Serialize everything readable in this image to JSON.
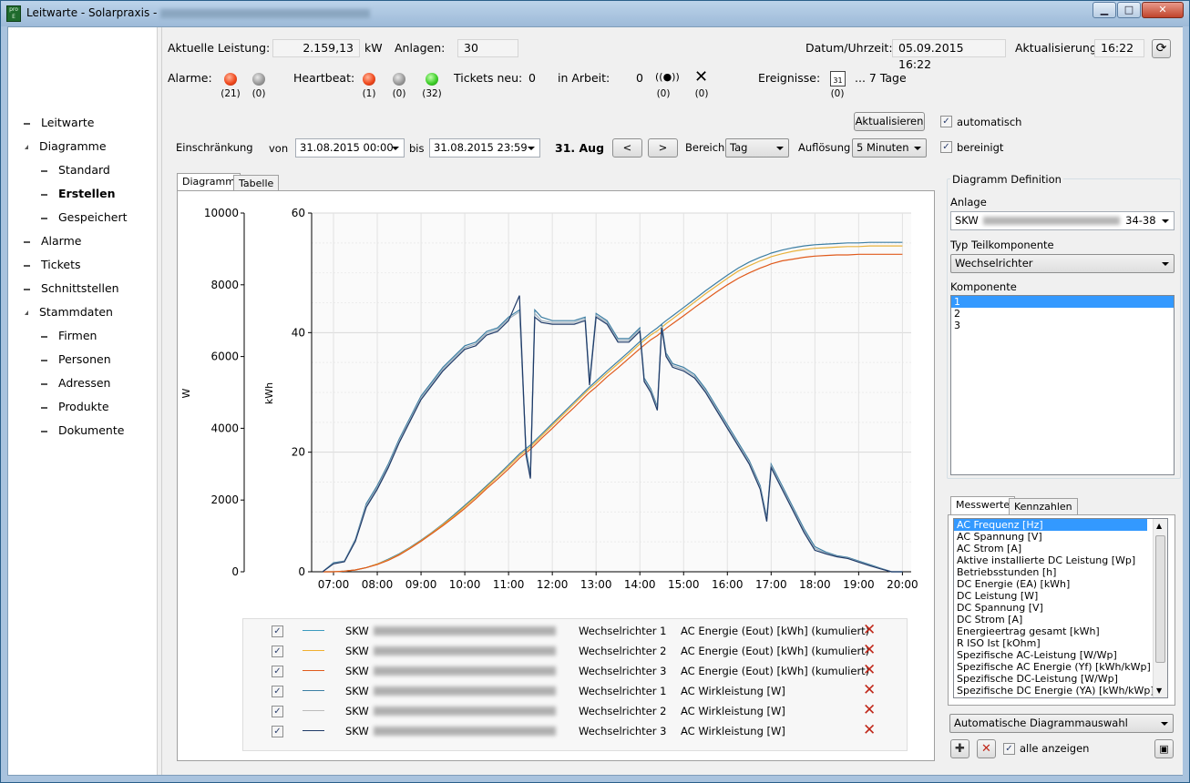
{
  "window": {
    "title": "Leitwarte - Solarpraxis -",
    "controls": {
      "minimize": "▁",
      "maximize": "□",
      "close": "✕"
    },
    "icon_text": "pro E"
  },
  "sidebar": {
    "items": [
      {
        "label": "Leitwarte",
        "level": 0
      },
      {
        "label": "Diagramme",
        "level": 0,
        "expanded": true
      },
      {
        "label": "Standard",
        "level": 1
      },
      {
        "label": "Erstellen",
        "level": 1,
        "selected": true
      },
      {
        "label": "Gespeichert",
        "level": 1
      },
      {
        "label": "Alarme",
        "level": 0
      },
      {
        "label": "Tickets",
        "level": 0
      },
      {
        "label": "Schnittstellen",
        "level": 0
      },
      {
        "label": "Stammdaten",
        "level": 0,
        "expanded": true
      },
      {
        "label": "Firmen",
        "level": 1
      },
      {
        "label": "Personen",
        "level": 1
      },
      {
        "label": "Adressen",
        "level": 1
      },
      {
        "label": "Produkte",
        "level": 1
      },
      {
        "label": "Dokumente",
        "level": 1
      }
    ]
  },
  "status": {
    "leistung_label": "Aktuelle Leistung:",
    "leistung_value": "2.159,13",
    "leistung_unit": "kW",
    "anlagen_label": "Anlagen:",
    "anlagen_value": "30",
    "datum_label": "Datum/Uhrzeit:",
    "datum_value": "05.09.2015 16:22",
    "aktualisierung_label": "Aktualisierung:",
    "aktualisierung_value": "16:22",
    "alarme_label": "Alarme:",
    "alarme_counts": [
      "(21)",
      "(0)"
    ],
    "heartbeat_label": "Heartbeat:",
    "heartbeat_counts": [
      "(1)",
      "(0)",
      "(32)"
    ],
    "tickets_neu_label": "Tickets neu:",
    "tickets_neu_value": "0",
    "in_arbeit_label": "in Arbeit:",
    "in_arbeit_value": "0",
    "ticket_icon_counts": [
      "(0)",
      "(0)"
    ],
    "ereignisse_label": "Ereignisse:",
    "ereignisse_value": "... 7 Tage",
    "ereignisse_count": "(0)",
    "calendar_day": "31"
  },
  "toolbar": {
    "aktualisieren_button": "Aktualisieren",
    "automatisch_label": "automatisch",
    "bereinigt_label": "bereinigt",
    "einschraenkung_label": "Einschränkung",
    "von_label": "von",
    "von_value": "31.08.2015 00:00",
    "bis_label": "bis",
    "bis_value": "31.08.2015 23:59",
    "date_display": "31. Aug",
    "prev_button": "<",
    "next_button": ">",
    "bereich_label": "Bereich",
    "bereich_value": "Tag",
    "aufloesung_label": "Auflösung",
    "aufloesung_value": "5 Minuten"
  },
  "tabs": {
    "diagramm": "Diagramm",
    "tabelle": "Tabelle"
  },
  "chart_data": {
    "type": "line",
    "y_left_label": "W",
    "y_right_label": "kWh",
    "y_left_ticks": [
      "10000",
      "8000",
      "6000",
      "4000",
      "2000",
      "0"
    ],
    "y_right_ticks": [
      "60",
      "40",
      "20",
      "0"
    ],
    "x_ticks": [
      "07:00",
      "08:00",
      "09:00",
      "10:00",
      "11:00",
      "12:00",
      "13:00",
      "14:00",
      "15:00",
      "16:00",
      "17:00",
      "18:00",
      "19:00",
      "20:00"
    ],
    "x": [
      6.75,
      7.0,
      7.25,
      7.5,
      7.75,
      8.0,
      8.25,
      8.5,
      8.75,
      9.0,
      9.25,
      9.5,
      9.75,
      10.0,
      10.25,
      10.5,
      10.75,
      11.0,
      11.25,
      11.4,
      11.5,
      11.6,
      11.75,
      12.0,
      12.25,
      12.5,
      12.75,
      12.85,
      13.0,
      13.25,
      13.5,
      13.75,
      14.0,
      14.1,
      14.25,
      14.4,
      14.5,
      14.6,
      14.75,
      15.0,
      15.25,
      15.5,
      15.75,
      16.0,
      16.25,
      16.5,
      16.75,
      16.9,
      17.0,
      17.25,
      17.5,
      17.75,
      18.0,
      18.25,
      18.5,
      18.75,
      19.0,
      19.25,
      19.5,
      19.75,
      20.0
    ],
    "power_series": [
      {
        "name": "Wechselrichter 1",
        "unit": "W",
        "color": "#3c7ea3",
        "values": [
          0,
          250,
          300,
          900,
          1900,
          2400,
          3000,
          3700,
          4300,
          4900,
          5300,
          5700,
          6000,
          6300,
          6400,
          6700,
          6800,
          7100,
          7300,
          3400,
          2700,
          7300,
          7100,
          7000,
          7000,
          7000,
          7100,
          5300,
          7200,
          7000,
          6500,
          6500,
          6800,
          5400,
          5100,
          4600,
          6900,
          6100,
          5800,
          5700,
          5500,
          5100,
          4600,
          4100,
          3600,
          3100,
          2400,
          1500,
          3000,
          2400,
          1800,
          1200,
          700,
          550,
          450,
          400,
          300,
          200,
          100,
          0,
          0
        ]
      },
      {
        "name": "Wechselrichter 2",
        "unit": "W",
        "color": "#9fb0bd",
        "values": [
          0,
          230,
          290,
          870,
          1850,
          2350,
          2950,
          3650,
          4250,
          4850,
          5250,
          5650,
          5950,
          6250,
          6350,
          6650,
          6750,
          7050,
          7250,
          3300,
          2650,
          7200,
          7000,
          6950,
          6950,
          6950,
          7050,
          5250,
          7150,
          6950,
          6450,
          6450,
          6750,
          5350,
          5050,
          4550,
          6850,
          6050,
          5750,
          5650,
          5450,
          5050,
          4550,
          4050,
          3550,
          3050,
          2350,
          1450,
          2950,
          2350,
          1750,
          1150,
          650,
          520,
          430,
          380,
          280,
          180,
          90,
          0,
          0
        ]
      },
      {
        "name": "Wechselrichter 3",
        "unit": "W",
        "color": "#1f3a68",
        "values": [
          0,
          220,
          280,
          850,
          1800,
          2300,
          2900,
          3600,
          4200,
          4800,
          5200,
          5600,
          5900,
          6200,
          6300,
          6600,
          6700,
          7000,
          7700,
          3250,
          2600,
          7100,
          6950,
          6900,
          6900,
          6900,
          7000,
          5200,
          7100,
          6900,
          6400,
          6400,
          6700,
          5300,
          5000,
          4500,
          6800,
          6000,
          5700,
          5600,
          5400,
          5000,
          4500,
          4000,
          3500,
          3000,
          2300,
          1400,
          2900,
          2300,
          1700,
          1100,
          600,
          500,
          420,
          370,
          270,
          170,
          80,
          0,
          0
        ]
      }
    ],
    "energy_series": [
      {
        "name": "Wechselrichter 1",
        "unit": "kWh",
        "color": "#3c7ea3",
        "values": [
          0,
          0,
          0.1,
          0.3,
          0.7,
          1.3,
          2.1,
          3.0,
          4.1,
          5.3,
          6.6,
          8.0,
          9.5,
          11.1,
          12.7,
          14.4,
          16.1,
          17.9,
          19.7,
          20.6,
          21.2,
          21.9,
          23.0,
          24.8,
          26.6,
          28.4,
          30.2,
          30.9,
          31.9,
          33.6,
          35.2,
          36.8,
          38.5,
          39.1,
          40.0,
          40.8,
          41.4,
          42.0,
          42.8,
          44.2,
          45.6,
          47.0,
          48.3,
          49.6,
          50.8,
          51.8,
          52.6,
          53.0,
          53.3,
          53.8,
          54.2,
          54.5,
          54.7,
          54.8,
          54.9,
          55.0,
          55.0,
          55.1,
          55.1,
          55.1,
          55.1
        ]
      },
      {
        "name": "Wechselrichter 2",
        "unit": "kWh",
        "color": "#e8b23c",
        "values": [
          0,
          0,
          0.1,
          0.3,
          0.7,
          1.3,
          2.0,
          2.9,
          4.0,
          5.2,
          6.5,
          7.9,
          9.3,
          10.9,
          12.5,
          14.2,
          15.9,
          17.6,
          19.4,
          20.3,
          20.9,
          21.6,
          22.7,
          24.5,
          26.3,
          28.1,
          29.9,
          30.6,
          31.5,
          33.2,
          34.8,
          36.4,
          38.1,
          38.7,
          39.6,
          40.3,
          40.9,
          41.5,
          42.3,
          43.7,
          45.1,
          46.5,
          47.8,
          49.1,
          50.3,
          51.2,
          52.0,
          52.4,
          52.7,
          53.2,
          53.6,
          53.9,
          54.1,
          54.2,
          54.3,
          54.4,
          54.4,
          54.5,
          54.5,
          54.5,
          54.5
        ]
      },
      {
        "name": "Wechselrichter 3",
        "unit": "kWh",
        "color": "#e05a1c",
        "values": [
          0,
          0,
          0.1,
          0.3,
          0.7,
          1.2,
          1.9,
          2.8,
          3.9,
          5.1,
          6.4,
          7.7,
          9.1,
          10.6,
          12.2,
          13.9,
          15.5,
          17.2,
          19.0,
          19.9,
          20.5,
          21.2,
          22.3,
          24.0,
          25.8,
          27.5,
          29.3,
          30.0,
          30.9,
          32.6,
          34.1,
          35.7,
          37.3,
          37.9,
          38.8,
          39.5,
          40.1,
          40.7,
          41.5,
          42.8,
          44.2,
          45.5,
          46.8,
          48.0,
          49.1,
          50.0,
          50.8,
          51.2,
          51.5,
          52.0,
          52.3,
          52.6,
          52.8,
          52.9,
          53.0,
          53.0,
          53.1,
          53.1,
          53.1,
          53.1,
          53.1
        ]
      }
    ],
    "y_left_range": [
      0,
      10000
    ],
    "y_right_range": [
      0,
      60
    ],
    "x_range": [
      6.5,
      20.2
    ],
    "grid": true
  },
  "legend": {
    "rows": [
      {
        "prefix": "SKW",
        "component": "Wechselrichter 1",
        "measure": "AC Energie (Eout) [kWh] (kumuliert)",
        "color": "#3c9bbf",
        "checked": true
      },
      {
        "prefix": "SKW",
        "component": "Wechselrichter 2",
        "measure": "AC Energie (Eout) [kWh] (kumuliert)",
        "color": "#f0b030",
        "checked": true
      },
      {
        "prefix": "SKW",
        "component": "Wechselrichter 3",
        "measure": "AC Energie (Eout) [kWh] (kumuliert)",
        "color": "#e05a1c",
        "checked": true
      },
      {
        "prefix": "SKW",
        "component": "Wechselrichter 1",
        "measure": "AC Wirkleistung [W]",
        "color": "#3c7ea3",
        "checked": true
      },
      {
        "prefix": "SKW",
        "component": "Wechselrichter 2",
        "measure": "AC Wirkleistung [W]",
        "color": "#bcbcbc",
        "checked": true
      },
      {
        "prefix": "SKW",
        "component": "Wechselrichter 3",
        "measure": "AC Wirkleistung [W]",
        "color": "#1f3a68",
        "checked": true
      }
    ],
    "remove_symbol": "✕"
  },
  "definition": {
    "group_title": "Diagramm Definition",
    "anlage_label": "Anlage",
    "anlage_prefix": "SKW",
    "anlage_suffix": "34-38",
    "typ_label": "Typ Teilkomponente",
    "typ_value": "Wechselrichter",
    "komponente_label": "Komponente",
    "komponenten": [
      "1",
      "2",
      "3"
    ],
    "tab_messwerte": "Messwerte",
    "tab_kennzahlen": "Kennzahlen",
    "messwerte": [
      "AC Frequenz [Hz]",
      "AC Spannung [V]",
      "AC Strom [A]",
      "Aktive installierte DC Leistung [Wp]",
      "Betriebsstunden [h]",
      "DC Energie (EA) [kWh]",
      "DC Leistung [W]",
      "DC Spannung [V]",
      "DC Strom [A]",
      "Energieertrag gesamt [kWh]",
      "R ISO Ist [kOhm]",
      "Spezifische AC-Leistung [W/Wp]",
      "Spezifische AC Energie (Yf) [kWh/kWp]",
      "Spezifische DC-Leistung [W/Wp]",
      "Spezifische DC Energie (YA) [kWh/kWp]"
    ],
    "auswahl_value": "Automatische Diagrammauswahl",
    "add_symbol": "✚",
    "remove_symbol": "✕",
    "alle_anzeigen_label": "alle anzeigen"
  }
}
